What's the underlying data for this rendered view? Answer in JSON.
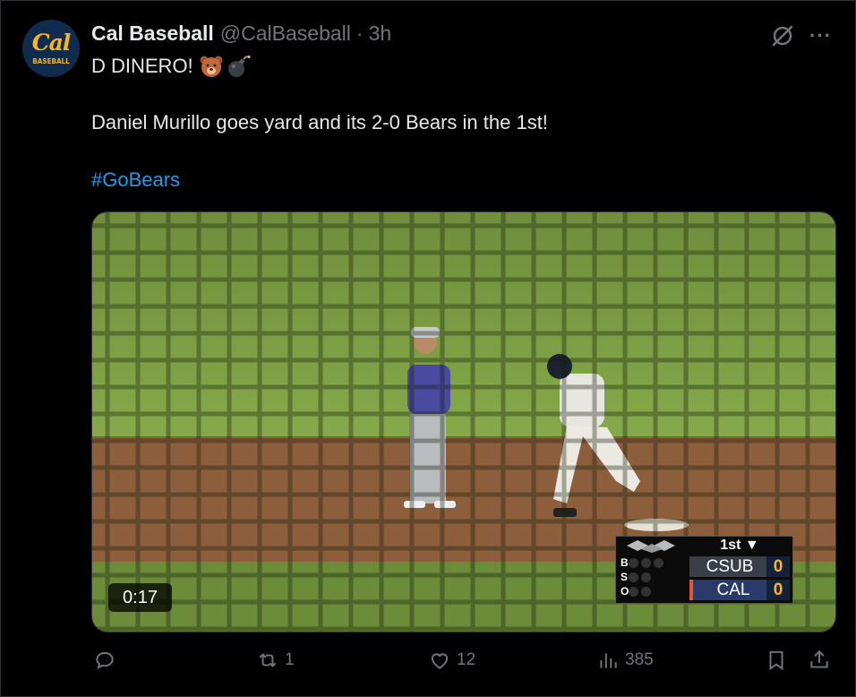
{
  "tweet": {
    "author_name": "Cal Baseball",
    "author_handle": "@CalBaseball",
    "separator": "·",
    "time": "3h",
    "avatar_text": "Cal",
    "avatar_subtext": "BASEBALL",
    "line1": "D DINERO!",
    "line1_emojis": [
      "bear-face",
      "bomb"
    ],
    "line2": "Daniel Murillo goes yard and its 2-0 Bears in the 1st!",
    "hashtag": "#GoBears",
    "more_label": "···"
  },
  "video": {
    "duration": "0:17",
    "scorebug": {
      "inning": "1st ▼",
      "bso_labels": [
        "B",
        "S",
        "O"
      ],
      "teams": [
        {
          "name": "CSUB",
          "score": "0"
        },
        {
          "name": "CAL",
          "score": "0"
        }
      ]
    }
  },
  "actions": {
    "replies": "",
    "reposts": "1",
    "likes": "12",
    "views": "385"
  },
  "colors": {
    "accent": "#1d9bf0",
    "muted": "#71767b",
    "cal_gold": "#fdb515",
    "cal_blue": "#0f2c4e"
  }
}
